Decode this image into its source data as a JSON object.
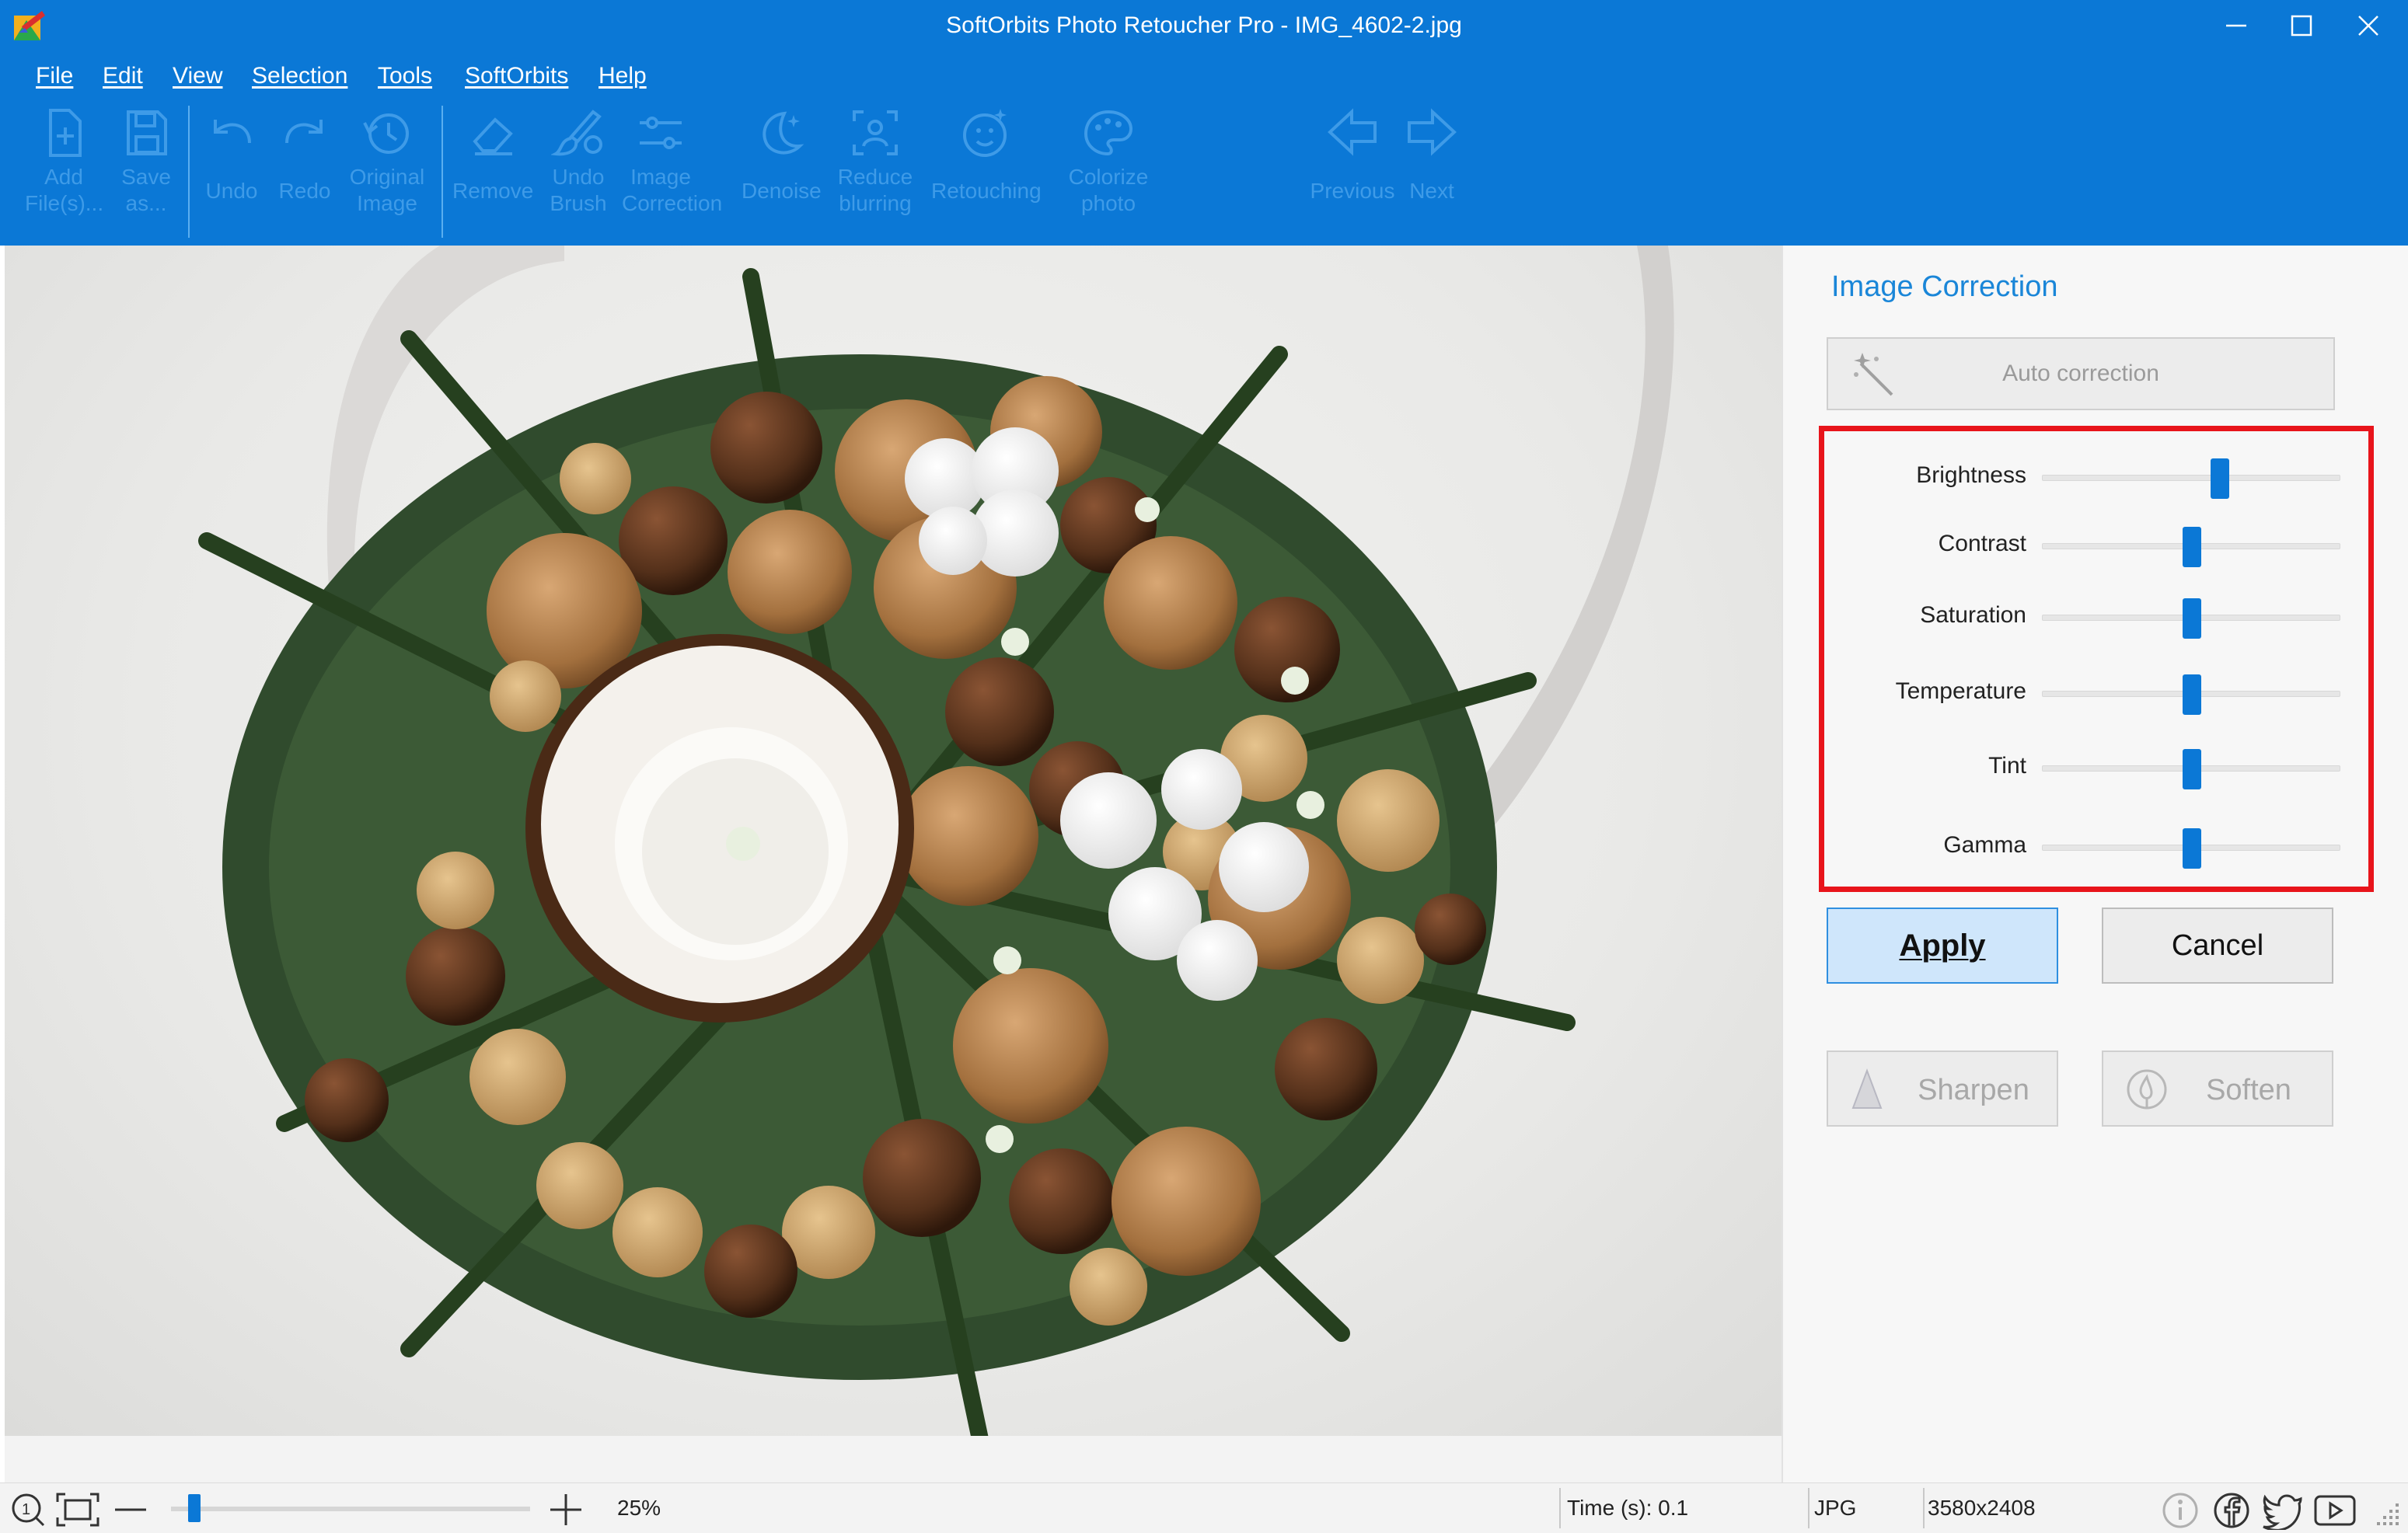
{
  "window": {
    "title": "SoftOrbits Photo Retoucher Pro - IMG_4602-2.jpg"
  },
  "menu": [
    "File",
    "Edit",
    "View",
    "Selection",
    "Tools",
    "SoftOrbits",
    "Help"
  ],
  "toolbar": {
    "add_files": [
      "Add",
      "File(s)..."
    ],
    "save_as": [
      "Save",
      "as..."
    ],
    "undo": [
      "Undo"
    ],
    "redo": [
      "Redo"
    ],
    "original_image": [
      "Original",
      "Image"
    ],
    "remove": [
      "Remove"
    ],
    "undo_brush": [
      "Undo",
      "Brush"
    ],
    "image_correction": [
      "Image",
      "Correction"
    ],
    "denoise": [
      "Denoise"
    ],
    "reduce_blurring": [
      "Reduce",
      "blurring"
    ],
    "retouching": [
      "Retouching"
    ],
    "colorize_photo": [
      "Colorize",
      "photo"
    ],
    "previous": [
      "Previous"
    ],
    "next": [
      "Next"
    ]
  },
  "panel": {
    "title": "Image Correction",
    "auto_correction": "Auto correction",
    "sliders": [
      {
        "label": "Brightness",
        "value": 0.6
      },
      {
        "label": "Contrast",
        "value": 0.5
      },
      {
        "label": "Saturation",
        "value": 0.5
      },
      {
        "label": "Temperature",
        "value": 0.5
      },
      {
        "label": "Tint",
        "value": 0.5
      },
      {
        "label": "Gamma",
        "value": 0.5
      }
    ],
    "apply": "Apply",
    "cancel": "Cancel",
    "sharpen": "Sharpen",
    "soften": "Soften"
  },
  "status": {
    "zoom": "25%",
    "zoom_value": 0.05,
    "time": "Time (s): 0.1",
    "format": "JPG",
    "dimensions": "3580x2408"
  },
  "colors": {
    "accent": "#0b78d6",
    "highlight_box": "#e8141b"
  }
}
